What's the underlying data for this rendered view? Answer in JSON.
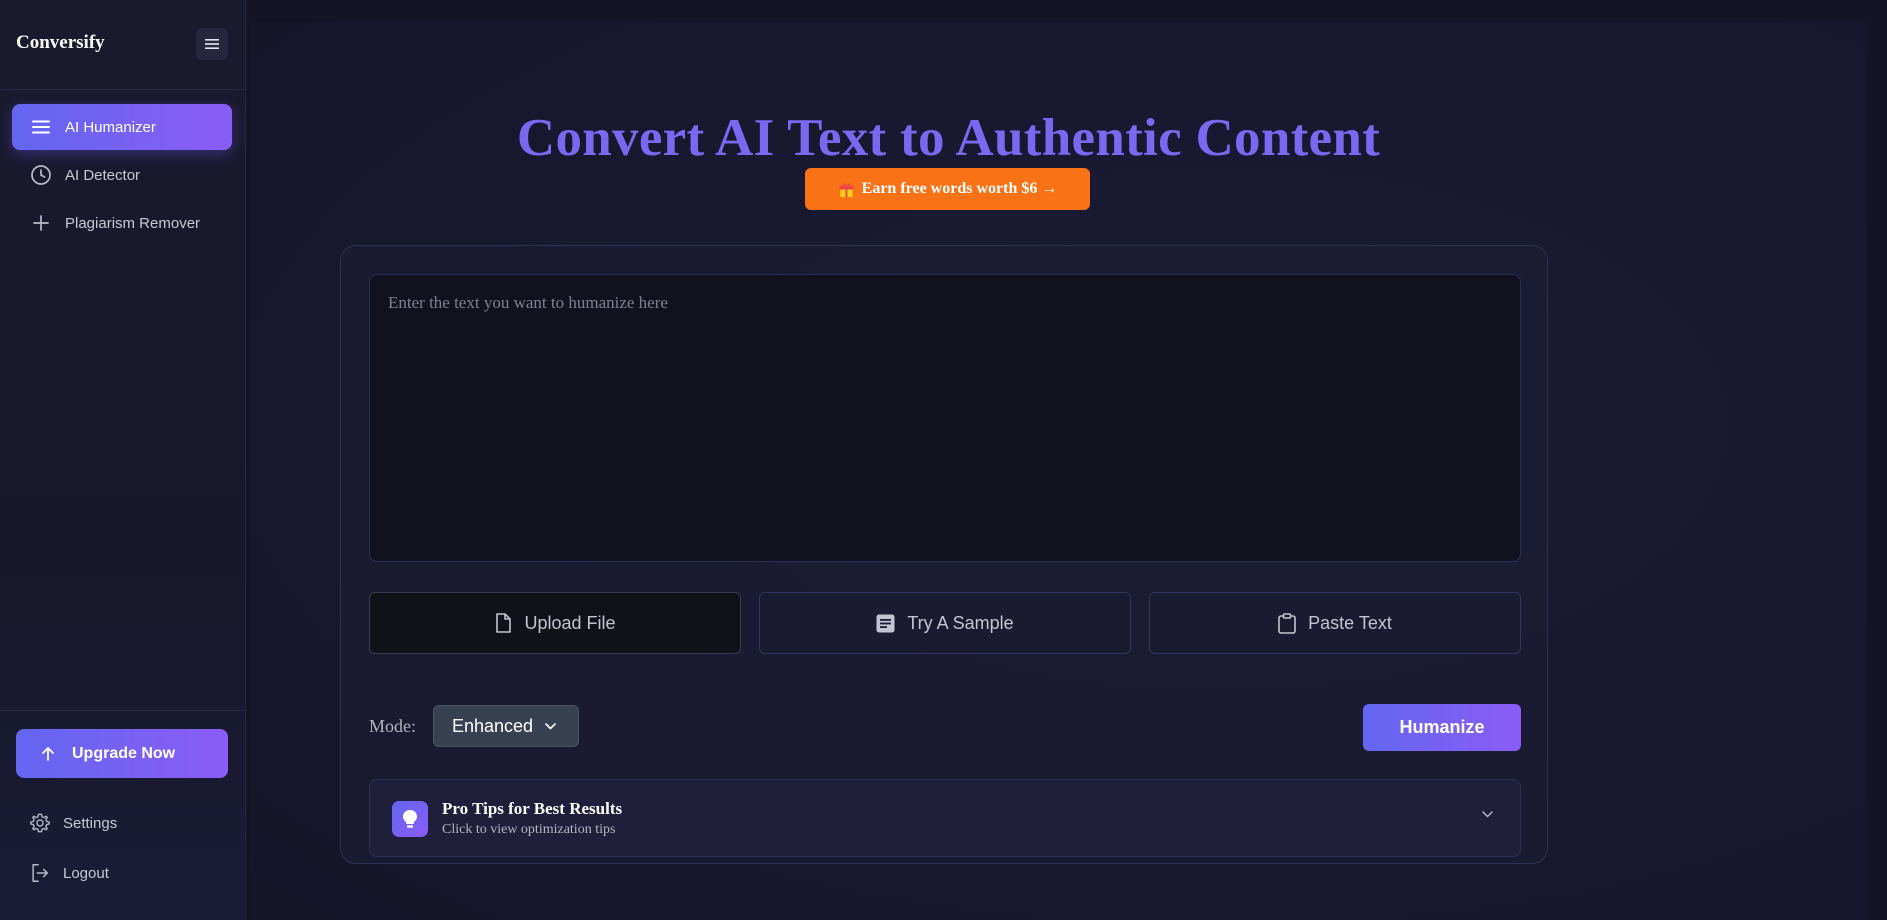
{
  "sidebar": {
    "brand": "Conversify",
    "nav": [
      {
        "label": "AI Humanizer",
        "icon": "menu-lines-icon",
        "active": true
      },
      {
        "label": "AI Detector",
        "icon": "clock-icon",
        "active": false
      },
      {
        "label": "Plagiarism Remover",
        "icon": "plus-icon",
        "active": false
      }
    ],
    "upgrade_label": "Upgrade Now",
    "settings_label": "Settings",
    "logout_label": "Logout"
  },
  "main": {
    "headline": "Convert AI Text to Authentic Content",
    "earn_label": "Earn free words worth $6 →",
    "editor": {
      "placeholder": "Enter the text you want to humanize here",
      "value": ""
    },
    "actions": {
      "upload_label": "Upload File",
      "sample_label": "Try A Sample",
      "paste_label": "Paste Text"
    },
    "mode": {
      "label": "Mode:",
      "selected": "Enhanced"
    },
    "humanize_label": "Humanize",
    "tips": {
      "title": "Pro Tips for Best Results",
      "subtitle": "Click to view optimization tips"
    }
  },
  "colors": {
    "accent_start": "#6366f1",
    "accent_end": "#8b5cf6",
    "headline": "#7a68f0",
    "earn_button": "#f97316"
  }
}
